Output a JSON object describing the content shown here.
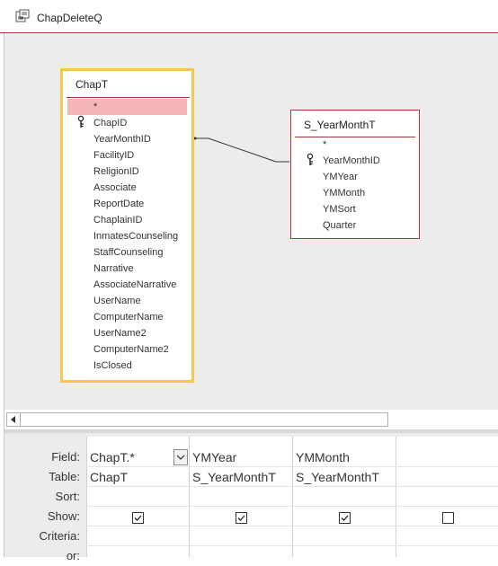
{
  "window": {
    "title": "ChapDeleteQ",
    "icon": "query-design-icon"
  },
  "tables": [
    {
      "name": "ChapT",
      "selected": true,
      "fields": [
        {
          "label": "*",
          "key": false,
          "highlight": true
        },
        {
          "label": "ChapID",
          "key": true
        },
        {
          "label": "YearMonthID",
          "key": false
        },
        {
          "label": "FacilityID",
          "key": false
        },
        {
          "label": "ReligionID",
          "key": false
        },
        {
          "label": "Associate",
          "key": false
        },
        {
          "label": "ReportDate",
          "key": false
        },
        {
          "label": "ChaplainID",
          "key": false
        },
        {
          "label": "InmatesCounseling",
          "key": false
        },
        {
          "label": "StaffCounseling",
          "key": false
        },
        {
          "label": "Narrative",
          "key": false
        },
        {
          "label": "AssociateNarrative",
          "key": false
        },
        {
          "label": "UserName",
          "key": false
        },
        {
          "label": "ComputerName",
          "key": false
        },
        {
          "label": "UserName2",
          "key": false
        },
        {
          "label": "ComputerName2",
          "key": false
        },
        {
          "label": "IsClosed",
          "key": false
        }
      ]
    },
    {
      "name": "S_YearMonthT",
      "selected": false,
      "fields": [
        {
          "label": "*",
          "key": false
        },
        {
          "label": "YearMonthID",
          "key": true
        },
        {
          "label": "YMYear",
          "key": false
        },
        {
          "label": "YMMonth",
          "key": false
        },
        {
          "label": "YMSort",
          "key": false
        },
        {
          "label": "Quarter",
          "key": false
        }
      ]
    }
  ],
  "grid": {
    "row_labels": {
      "field": "Field:",
      "table": "Table:",
      "sort": "Sort:",
      "show": "Show:",
      "criteria": "Criteria:",
      "or": "or:"
    },
    "columns": [
      {
        "field": "ChapT.*",
        "table": "ChapT",
        "sort": "",
        "show": true,
        "criteria": "",
        "dropdown": true
      },
      {
        "field": "YMYear",
        "table": "S_YearMonthT",
        "sort": "",
        "show": true,
        "criteria": ""
      },
      {
        "field": "YMMonth",
        "table": "S_YearMonthT",
        "sort": "",
        "show": true,
        "criteria": ""
      },
      {
        "field": "",
        "table": "",
        "sort": "",
        "show": false,
        "criteria": ""
      }
    ]
  },
  "colors": {
    "accent": "#a4373a",
    "selected_border": "#f9c74f",
    "highlight_row": "#f4b6b6",
    "pane_bg": "#ececec"
  }
}
